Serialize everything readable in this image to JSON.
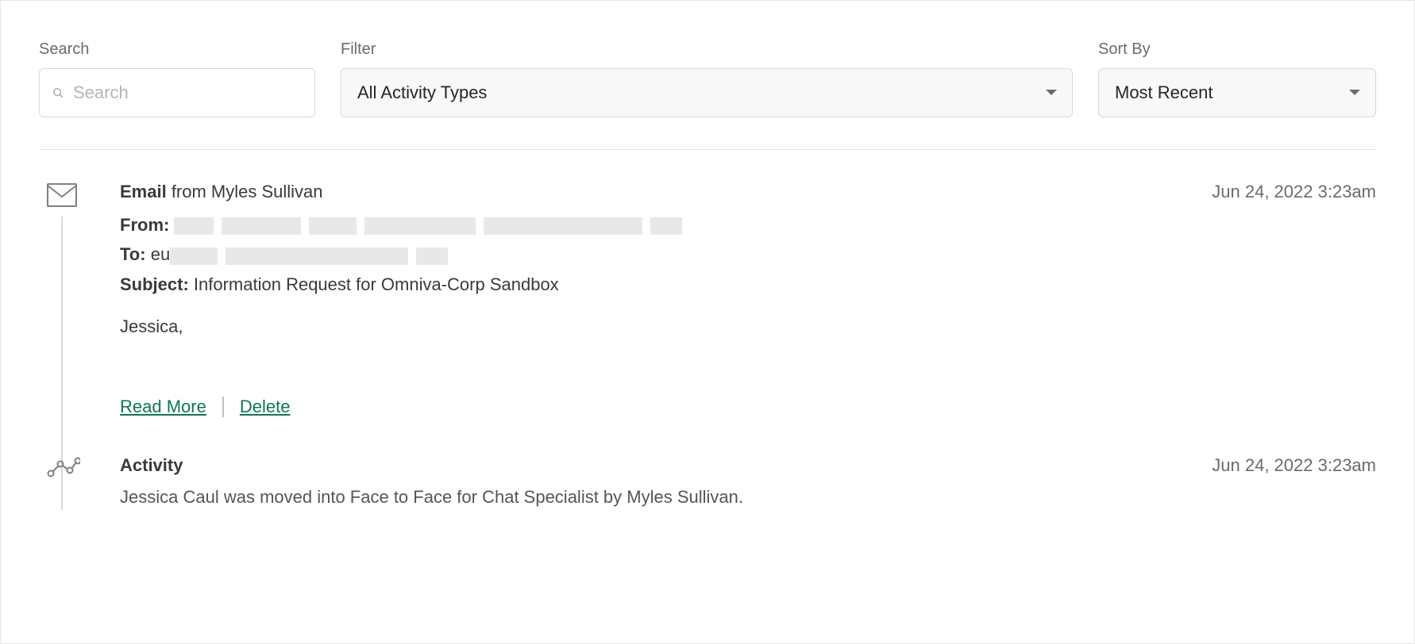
{
  "controls": {
    "search": {
      "label": "Search",
      "placeholder": "Search"
    },
    "filter": {
      "label": "Filter",
      "value": "All Activity Types"
    },
    "sort": {
      "label": "Sort By",
      "value": "Most Recent"
    }
  },
  "feed": [
    {
      "type": "email",
      "title_prefix": "Email",
      "title_suffix": " from Myles Sullivan",
      "timestamp": "Jun 24, 2022 3:23am",
      "from_label": "From:",
      "to_label": "To:",
      "to_value_prefix": "eu",
      "subject_label": "Subject:",
      "subject_value": " Information Request for Omniva-Corp Sandbox",
      "body_preview": "Jessica,",
      "read_more": "Read More",
      "delete": "Delete"
    },
    {
      "type": "activity",
      "title": "Activity",
      "timestamp": "Jun 24, 2022 3:23am",
      "text": "Jessica Caul was moved into Face to Face for Chat Specialist by Myles Sullivan."
    }
  ]
}
